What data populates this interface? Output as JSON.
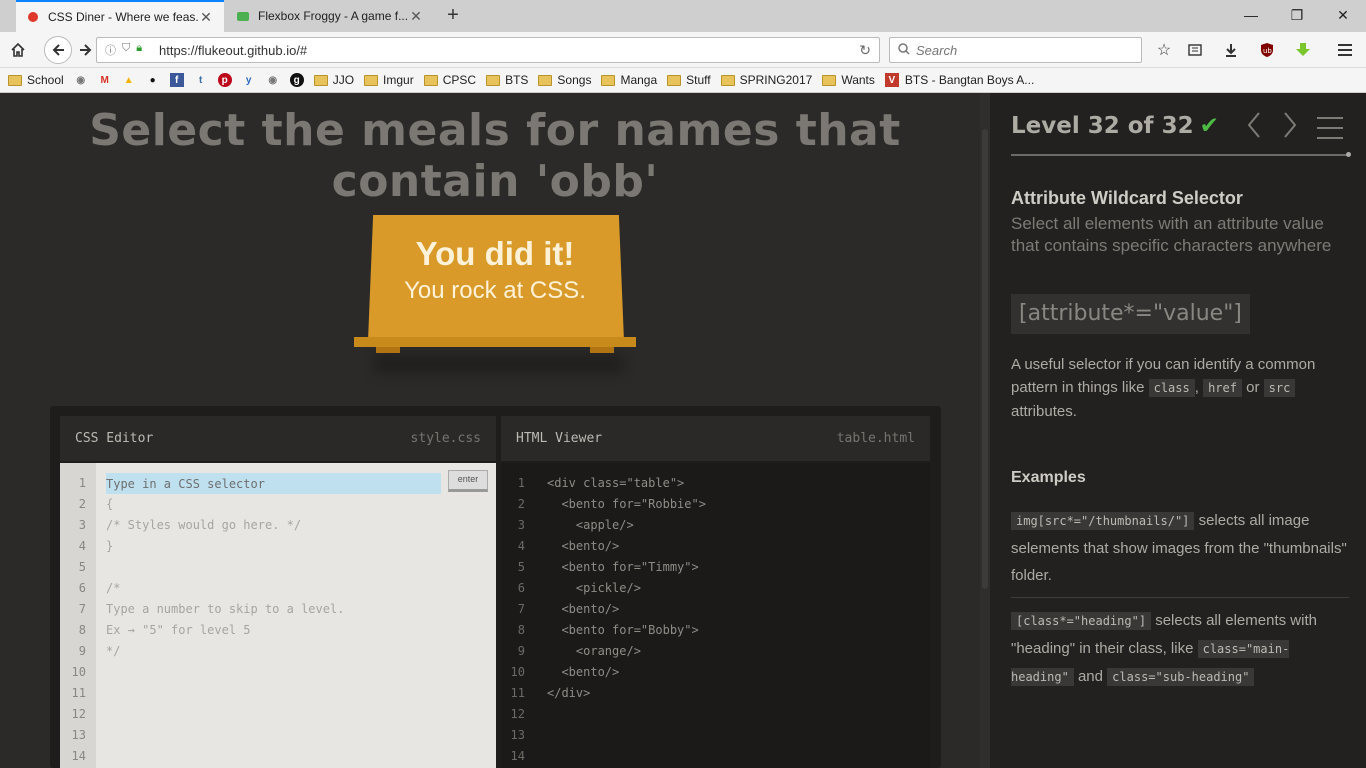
{
  "browser": {
    "tabs": [
      {
        "title": "CSS Diner - Where we feas...",
        "active": true
      },
      {
        "title": "Flexbox Froggy - A game f...",
        "active": false
      }
    ],
    "url": "https://flukeout.github.io/#",
    "search_placeholder": "Search",
    "bookmarks": [
      "School",
      "JJO",
      "Imgur",
      "CPSC",
      "BTS",
      "Songs",
      "Manga",
      "Stuff",
      "SPRING2017",
      "Wants",
      "BTS - Bangtan Boys A..."
    ]
  },
  "game": {
    "order": "Select the meals for names that contain 'obb'",
    "win_line1": "You did it!",
    "win_line2": "You rock at CSS."
  },
  "css_editor": {
    "title": "CSS Editor",
    "filename": "style.css",
    "placeholder": "Type in a CSS selector",
    "enter_label": "enter",
    "line_numbers": [
      "1",
      "2",
      "3",
      "4",
      "5",
      "6",
      "7",
      "8",
      "9",
      "10",
      "11",
      "12",
      "13",
      "14"
    ],
    "lines": [
      "",
      "{",
      "/* Styles would go here. */",
      "}",
      "",
      "/*",
      "Type a number to skip to a level.",
      "Ex → \"5\" for level 5",
      "*/",
      "",
      "",
      "",
      "",
      ""
    ]
  },
  "html_viewer": {
    "title": "HTML Viewer",
    "filename": "table.html",
    "line_numbers": [
      "1",
      "2",
      "3",
      "4",
      "5",
      "6",
      "7",
      "8",
      "9",
      "10",
      "11",
      "12",
      "13",
      "14"
    ],
    "lines": [
      "<div class=\"table\">",
      "  <bento for=\"Robbie\">",
      "    <apple/>",
      "  <bento/>",
      "  <bento for=\"Timmy\">",
      "    <pickle/>",
      "  <bento/>",
      "  <bento for=\"Bobby\">",
      "    <orange/>",
      "  <bento/>",
      "</div>",
      "",
      "",
      ""
    ]
  },
  "sidebar": {
    "level_text": "Level 32 of 32",
    "check": "✔",
    "selector_name": "Attribute Wildcard Selector",
    "selector_title": "Select all elements with an attribute value that contains specific characters anywhere",
    "syntax": "[attribute*=\"value\"]",
    "hint_pre": "A useful selector if you can identify a common pattern in things like",
    "hint_code1": "class",
    "hint_comma": ",",
    "hint_code2": "href",
    "hint_or": "or",
    "hint_code3": "src",
    "hint_post": "attributes.",
    "examples_title": "Examples",
    "ex1_code": "img[src*=\"/thumbnails/\"]",
    "ex1_text": "selects all image selements that show images from the \"thumbnails\" folder.",
    "ex2_code": "[class*=\"heading\"]",
    "ex2_text": "selects all elements with \"heading\" in their class, like",
    "ex2_code2": "class=\"main-heading\"",
    "ex2_and": "and",
    "ex2_code3": "class=\"sub-heading\""
  }
}
